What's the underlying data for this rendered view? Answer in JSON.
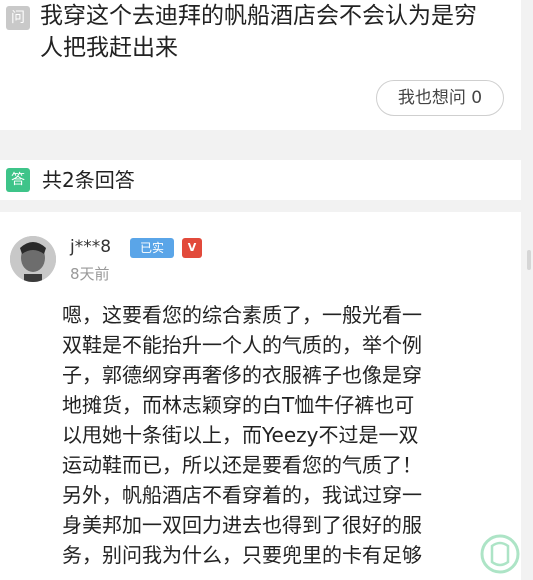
{
  "question": {
    "badge": "问",
    "title_lines": [
      "我穿这个去迪拜的帆船酒店会不会认为是穷",
      "人把我赶出来"
    ],
    "me_too_label": "我也想问 0"
  },
  "answers_header": {
    "badge": "答",
    "count_label": "共2条回答"
  },
  "reply": {
    "username": "j***8",
    "verified_badge": "已实",
    "level_badge": "V",
    "timestamp": "8天前",
    "lines": [
      "嗯，这要看您的综合素质了，一般光看一",
      "双鞋是不能抬升一个人的气质的，举个例",
      "子，郭德纲穿再奢侈的衣服裤子也像是穿",
      "地摊货，而林志颖穿的白T恤牛仔裤也可",
      "以甩她十条街以上，而Yeezy不过是一双",
      "运动鞋而已，所以还是要看您的气质了！",
      "另外，帆船酒店不看穿着的，我试过穿一",
      "身美邦加一双回力进去也得到了很好的服",
      "务，别问我为什么，只要兜里的卡有足够"
    ]
  },
  "colors": {
    "answer_badge": "#3ec489",
    "question_badge": "#c9c9c9",
    "verified_badge": "#5aa5e8",
    "level_badge": "#e24a3b"
  }
}
